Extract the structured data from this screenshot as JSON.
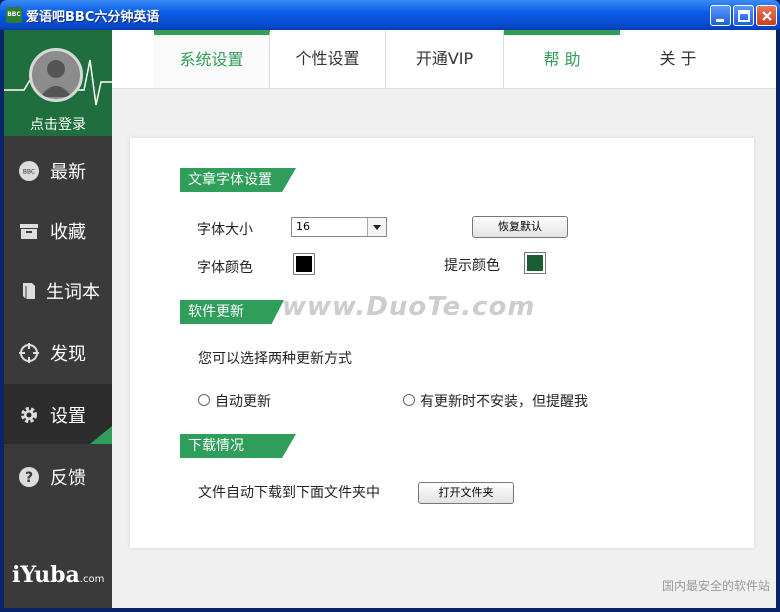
{
  "window": {
    "title": "爱语吧BBC六分钟英语",
    "app_icon_text": "BBC"
  },
  "sidebar": {
    "login_label": "点击登录",
    "items": [
      {
        "label": "最新",
        "icon": "bbc-badge-icon"
      },
      {
        "label": "收藏",
        "icon": "archive-box-icon"
      },
      {
        "label": "生词本",
        "icon": "book-icon"
      },
      {
        "label": "发现",
        "icon": "crosshair-icon"
      },
      {
        "label": "设置",
        "icon": "gear-icon",
        "active": true
      },
      {
        "label": "反馈",
        "icon": "question-icon"
      }
    ],
    "logo": {
      "main": "iYuba",
      "suffix": ".com"
    }
  },
  "tabs": [
    {
      "label": "系统设置",
      "active": true
    },
    {
      "label": "个性设置"
    },
    {
      "label": "开通VIP"
    },
    {
      "label": "帮 助"
    },
    {
      "label": "关 于"
    }
  ],
  "settings": {
    "font_section": {
      "header": "文章字体设置",
      "font_size_label": "字体大小",
      "font_size_value": "16",
      "restore_default": "恢复默认",
      "font_color_label": "字体颜色",
      "font_color": "#000000",
      "hint_color_label": "提示颜色",
      "hint_color": "#1a5e34"
    },
    "update_section": {
      "header": "软件更新",
      "description": "您可以选择两种更新方式",
      "option_auto": "自动更新",
      "option_notify": "有更新时不安装，但提醒我"
    },
    "download_section": {
      "header": "下载情况",
      "description": "文件自动下载到下面文件夹中",
      "open_folder": "打开文件夹"
    }
  },
  "watermark": "www.DuoTe.com",
  "corner_watermark": "国内最安全的软件站",
  "colors": {
    "accent": "#2e9e5a",
    "sidebar_bg": "#3a3a3a",
    "profile_bg": "#1f6f3e"
  }
}
